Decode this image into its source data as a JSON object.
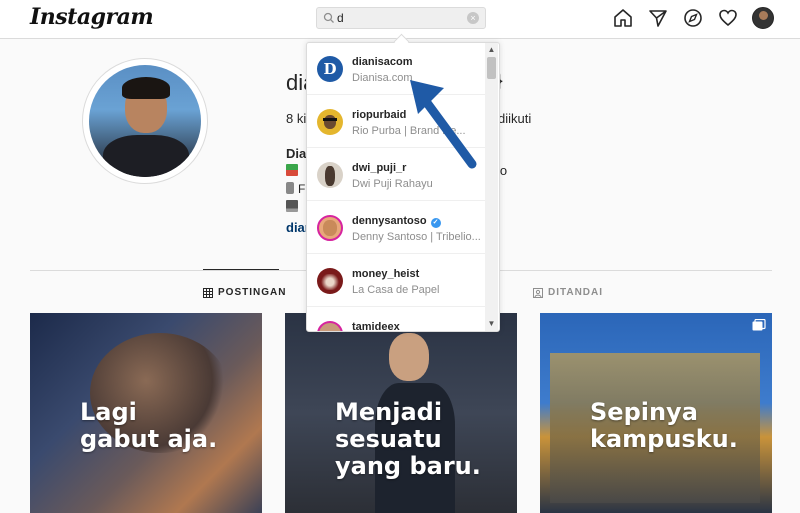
{
  "header": {
    "logo": "Instagram",
    "search": {
      "value": "d",
      "clear_icon": "×"
    },
    "nav_icons": [
      "home-icon",
      "direct-message-icon",
      "explore-icon",
      "activity-heart-icon",
      "profile-avatar"
    ]
  },
  "profile": {
    "username_partial": "dia",
    "username_suffix": "}",
    "stats_left": "8 ki",
    "stats_right": "diikuti",
    "bio_name": "Dia",
    "bio_lines": [
      {
        "icon": "book-emoji",
        "text": ""
      },
      {
        "icon": "phone-emoji",
        "text": "F"
      },
      {
        "icon": "laptop-emoji",
        "text": ""
      }
    ],
    "bio_right": "jo",
    "bio_link": "diar"
  },
  "tabs": [
    {
      "label": "POSTINGAN",
      "icon": "grid-icon",
      "active": true
    },
    {
      "label": "DITANDAI",
      "icon": "tagged-icon",
      "active": false
    }
  ],
  "posts": [
    {
      "caption": "Lagi\ngabut aja",
      "dot": "."
    },
    {
      "caption": "Menjadi\nsesuatu\nyang baru",
      "dot": "."
    },
    {
      "caption": "Sepinya\nkampusku",
      "dot": "."
    }
  ],
  "search_results": [
    {
      "username": "dianisacom",
      "fullname": "Dianisa.com",
      "verified": false,
      "avatar_letter": "D"
    },
    {
      "username": "riopurbaid",
      "fullname": "Rio Purba | Brand De...",
      "verified": false
    },
    {
      "username": "dwi_puji_r",
      "fullname": "Dwi Puji Rahayu",
      "verified": false
    },
    {
      "username": "dennysantoso",
      "fullname": "Denny Santoso | Tribelio...",
      "verified": true
    },
    {
      "username": "money_heist",
      "fullname": "La Casa de Papel",
      "verified": false
    },
    {
      "username": "tamideex",
      "fullname": "",
      "verified": false
    }
  ],
  "colors": {
    "accent": "#3897f0",
    "arrow": "#1f5aa6",
    "story_ring": "#d6249f"
  }
}
